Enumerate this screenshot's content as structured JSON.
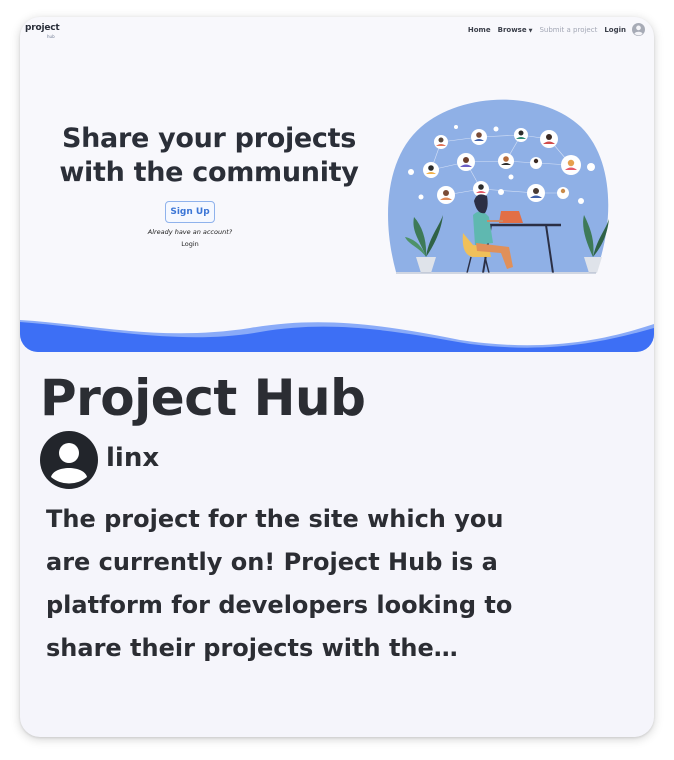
{
  "nav": {
    "logo_text": "project",
    "logo_sub": "hub",
    "home": "Home",
    "browse": "Browse",
    "submit": "Submit a project",
    "login": "Login"
  },
  "hero": {
    "title_line1": "Share your projects",
    "title_line2": "with the community",
    "signup": "Sign Up",
    "already": "Already have an account?",
    "login": "Login"
  },
  "project": {
    "title": "Project Hub",
    "author": "linx",
    "description_lines": [
      "The project for the site which you",
      "are currently on! Project Hub is a",
      "platform for developers looking to",
      "share their projects with the…"
    ]
  },
  "colors": {
    "accent": "#3d6ff5",
    "blob": "#8fb0e6",
    "card_bg": "#f5f5fb"
  },
  "icons": [
    "user-avatar-icon",
    "caret-down-icon"
  ]
}
